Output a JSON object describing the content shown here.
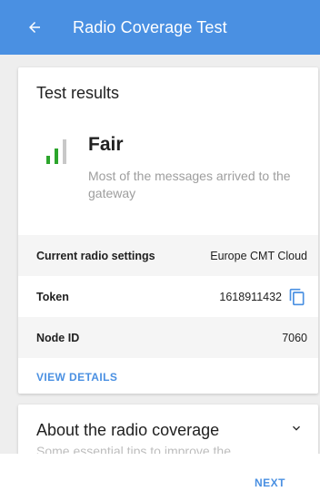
{
  "header": {
    "title": "Radio Coverage Test",
    "back_icon": "arrow-left-icon"
  },
  "results": {
    "title": "Test results",
    "signal": {
      "level": 2,
      "max_level": 3,
      "colors": {
        "active": "#2ca52c",
        "inactive": "#c8c8c8"
      }
    },
    "status": "Fair",
    "description": "Most of the messages arrived to the gateway",
    "settings": [
      {
        "label": "Current radio settings",
        "value": "Europe CMT Cloud"
      },
      {
        "label": "Token",
        "value": "1618911432"
      },
      {
        "label": "Node ID",
        "value": "7060"
      }
    ],
    "view_details": "VIEW DETAILS"
  },
  "about": {
    "title": "About the radio coverage",
    "subtitle": "Some essential tips to improve the"
  },
  "footer": {
    "next": "NEXT"
  },
  "colors": {
    "accent": "#4a90e2"
  }
}
